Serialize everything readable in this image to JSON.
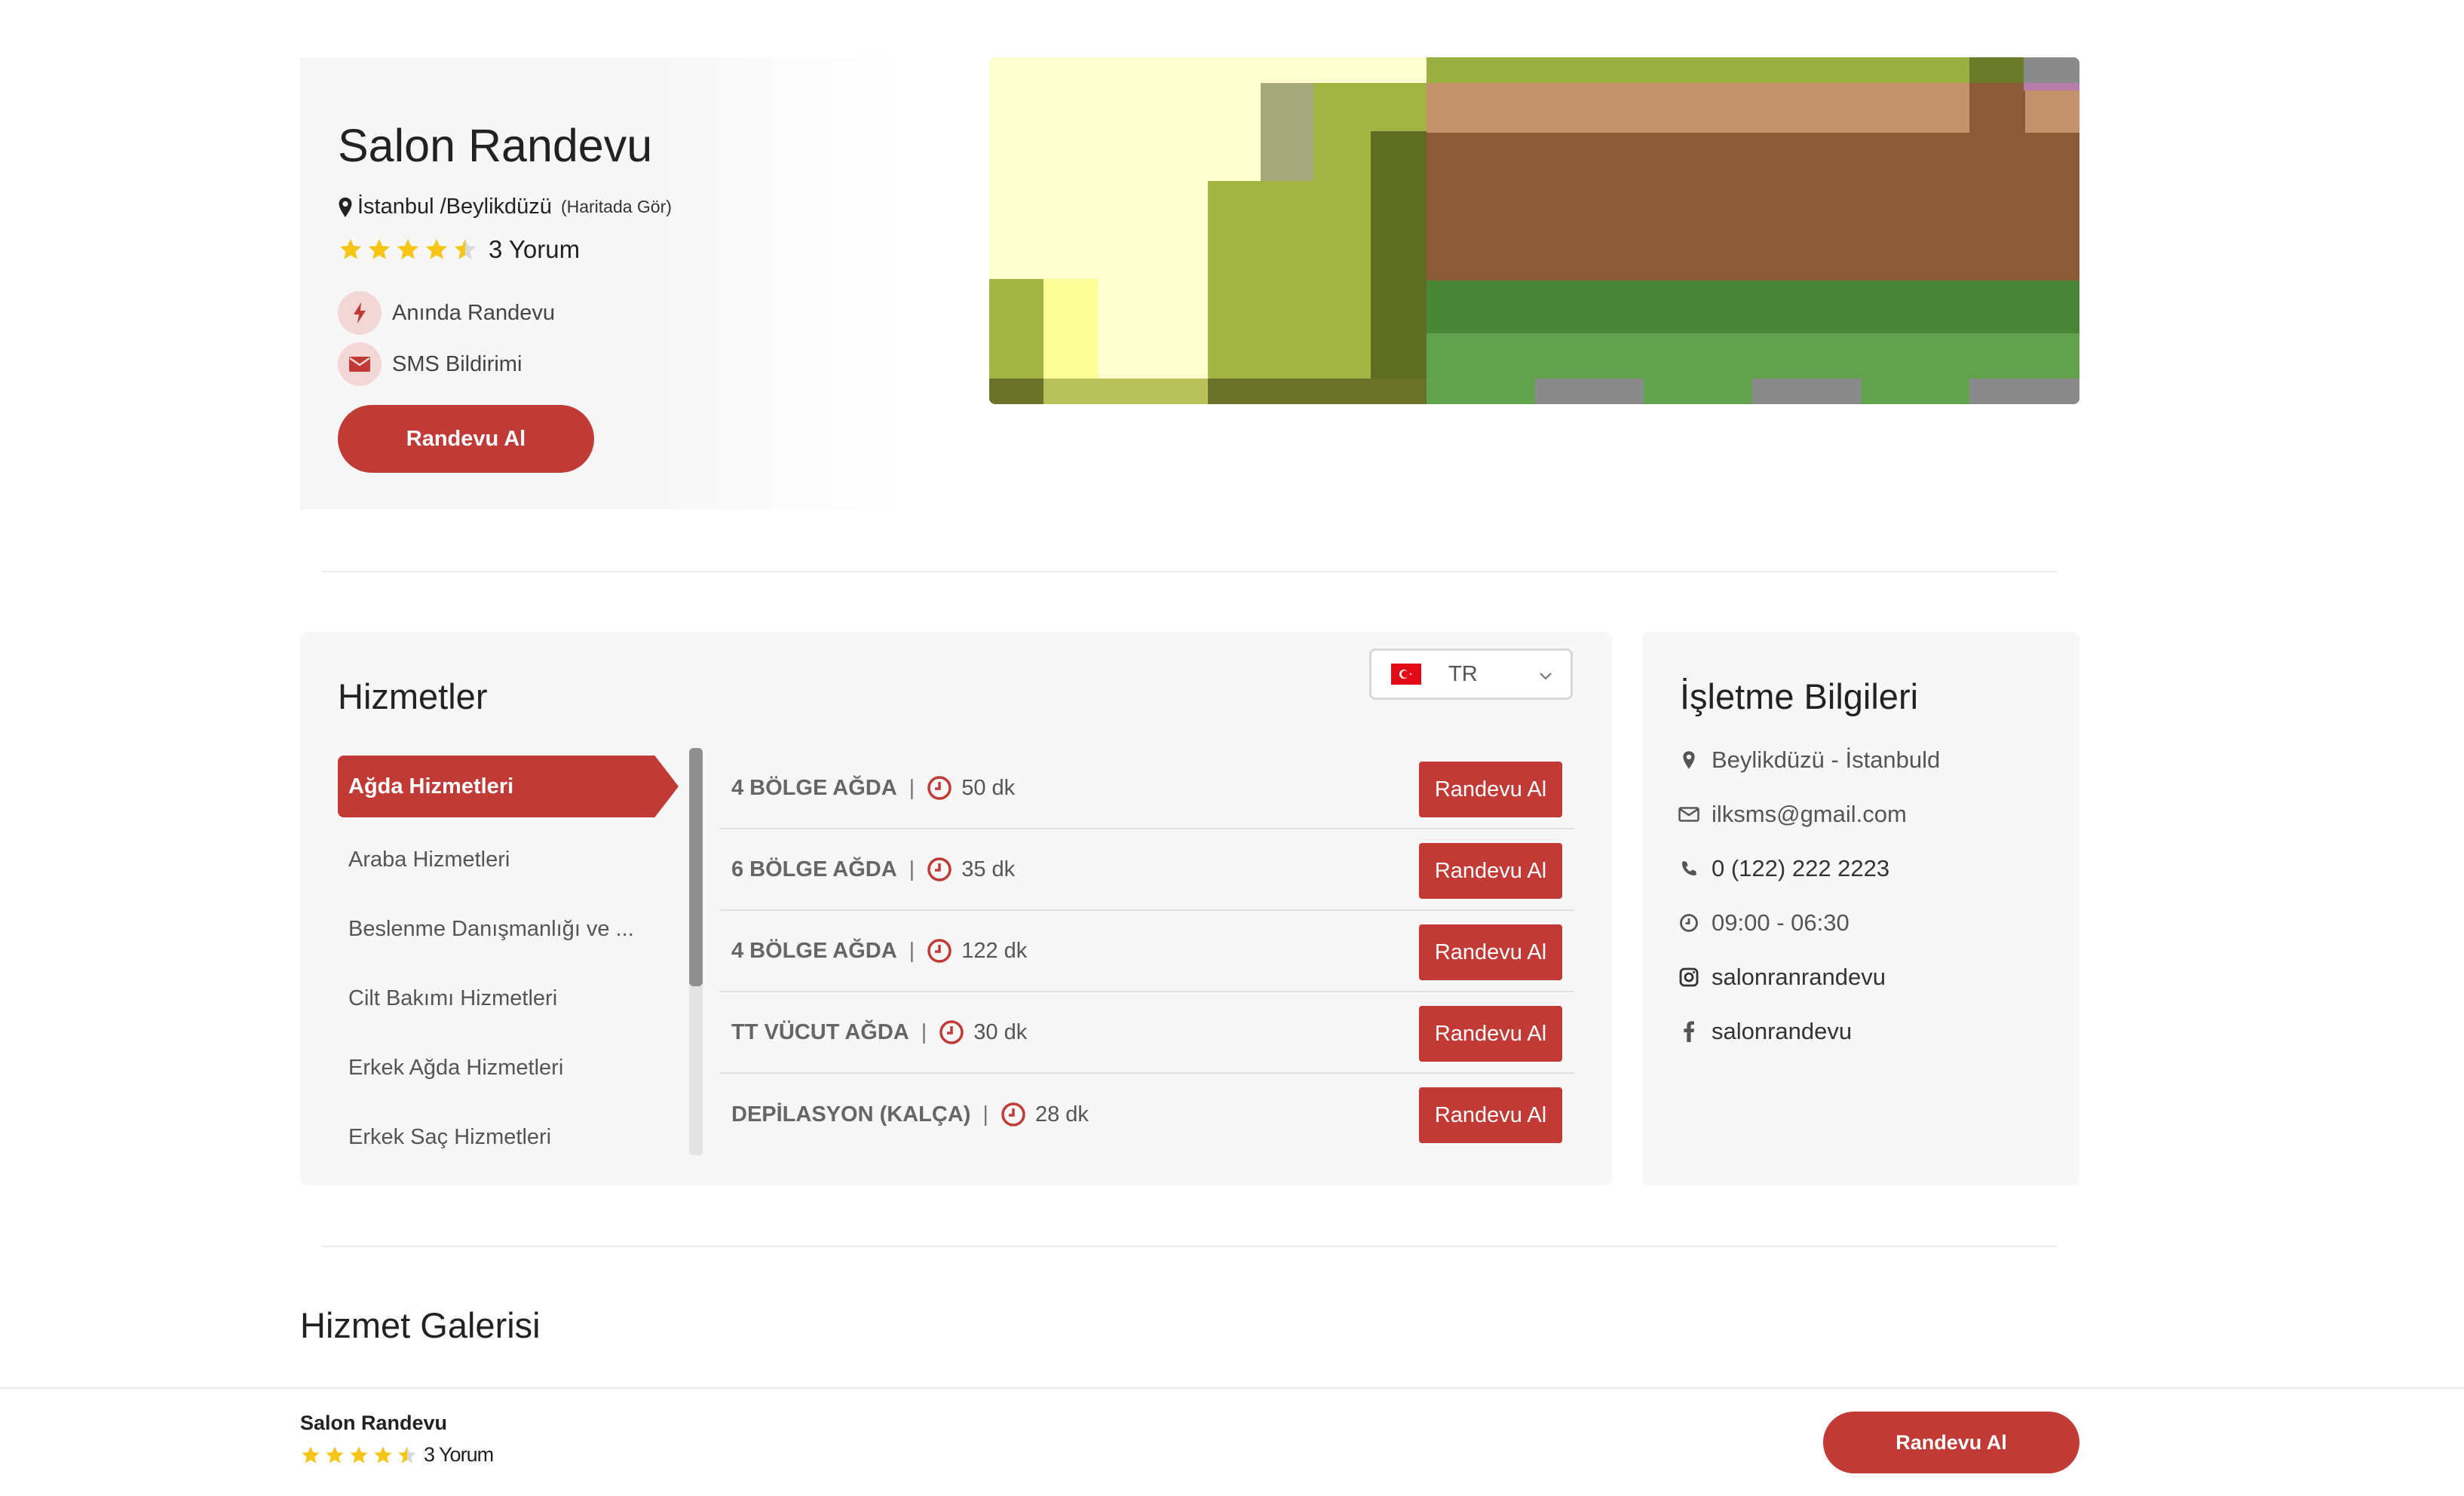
{
  "hero": {
    "title": "Salon Randevu",
    "location": "İstanbul /Beylikdüzü",
    "map_link": "(Haritada Gör)",
    "rating": 4.5,
    "reviews": "3 Yorum",
    "features": [
      {
        "label": "Anında Randevu",
        "icon": "bolt-icon"
      },
      {
        "label": "SMS Bildirimi",
        "icon": "envelope-icon"
      }
    ],
    "book_label": "Randevu Al"
  },
  "services": {
    "title": "Hizmetler",
    "language": "TR",
    "categories": [
      "Ağda Hizmetleri",
      "Araba Hizmetleri",
      "Beslenme Danışmanlığı ve ...",
      "Cilt Bakımı Hizmetleri",
      "Erkek Ağda Hizmetleri",
      "Erkek Saç Hizmetleri"
    ],
    "active_category": "Ağda Hizmetleri",
    "items": [
      {
        "name": "4 BÖLGE AĞDA",
        "duration": "50 dk",
        "button": "Randevu Al"
      },
      {
        "name": "6 BÖLGE AĞDA",
        "duration": "35 dk",
        "button": "Randevu Al"
      },
      {
        "name": "4 BÖLGE AĞDA",
        "duration": "122 dk",
        "button": "Randevu Al"
      },
      {
        "name": "TT VÜCUT AĞDA",
        "duration": "30 dk",
        "button": "Randevu Al"
      },
      {
        "name": "DEPİLASYON (KALÇA)",
        "duration": "28 dk",
        "button": "Randevu Al"
      }
    ],
    "separator": "|"
  },
  "info": {
    "title": "İşletme Bilgileri",
    "address": "Beylikdüzü - İstanbuld",
    "email": "ilksms@gmail.com",
    "phone": "0 (122) 222 2223",
    "hours": "09:00 - 06:30",
    "instagram": "salonranrandevu",
    "facebook": "salonrandevu"
  },
  "gallery": {
    "title": "Hizmet Galerisi"
  },
  "bottom_bar": {
    "name": "Salon Randevu",
    "reviews": "3 Yorum",
    "book_label": "Randevu Al"
  },
  "colors": {
    "accent": "#c23a36",
    "star": "#f5c518"
  }
}
